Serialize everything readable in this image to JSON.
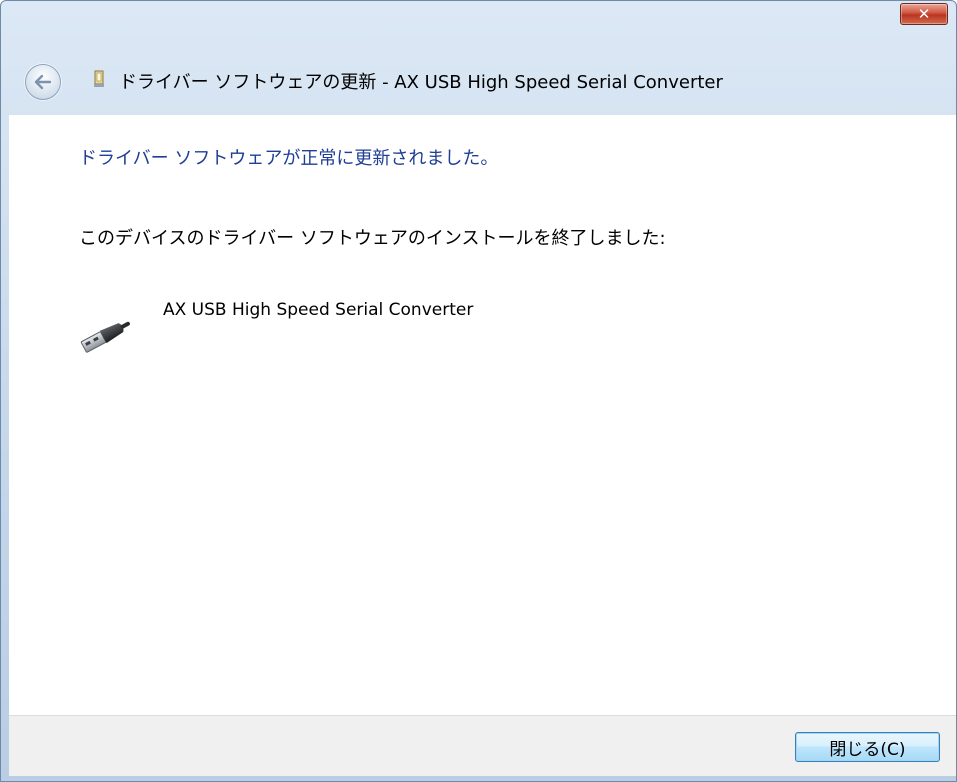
{
  "window": {
    "title": "ドライバー ソフトウェアの更新 - AX USB High Speed Serial Converter",
    "close_glyph": "✕",
    "back_icon": "back-arrow-icon"
  },
  "content": {
    "heading": "ドライバー ソフトウェアが正常に更新されました。",
    "description": "このデバイスのドライバー ソフトウェアのインストールを終了しました:",
    "device": {
      "name": "AX USB High Speed Serial Converter",
      "icon": "usb-plug-icon"
    }
  },
  "footer": {
    "close_button_label": "閉じる(C)"
  },
  "colors": {
    "heading": "#1f3f95",
    "titlebar": "#c4d6ea",
    "footer": "#f0f0f0"
  }
}
